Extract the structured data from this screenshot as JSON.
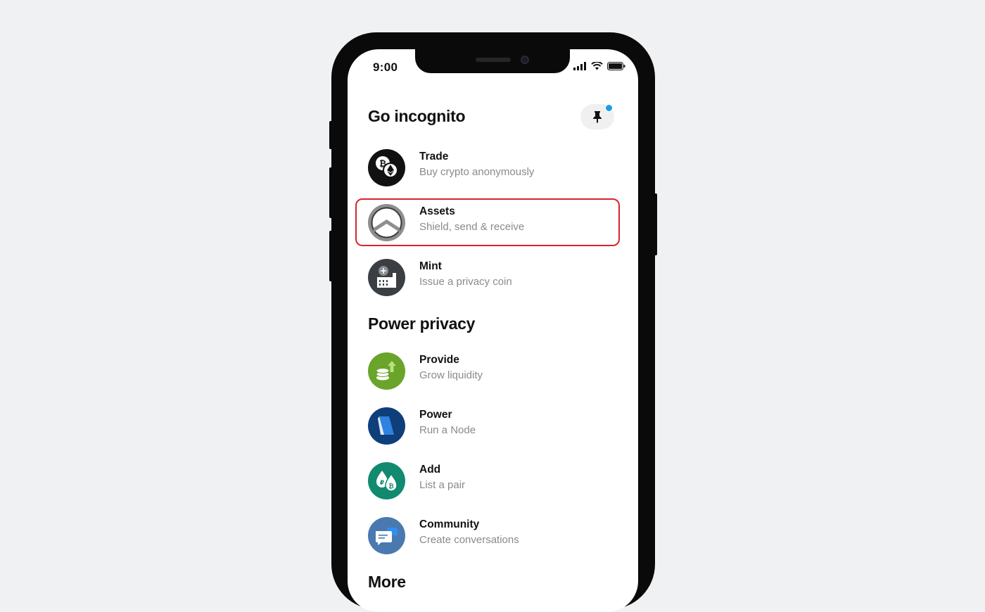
{
  "status_bar": {
    "time": "9:00"
  },
  "sections": {
    "go_incognito": {
      "title": "Go incognito"
    },
    "power_privacy": {
      "title": "Power privacy"
    },
    "more": {
      "title": "More"
    }
  },
  "items": [
    {
      "title": "Trade",
      "subtitle": "Buy crypto anonymously",
      "icon": "trade-crypto-icon",
      "color": "#111111"
    },
    {
      "title": "Assets",
      "subtitle": "Shield, send & receive",
      "icon": "assets-shield-icon",
      "color": "#8e8e8e",
      "highlighted": true
    },
    {
      "title": "Mint",
      "subtitle": "Issue a privacy coin",
      "icon": "mint-factory-icon",
      "color": "#3b3f44"
    },
    {
      "title": "Provide",
      "subtitle": "Grow liquidity",
      "icon": "provide-coins-icon",
      "color": "#6aa42a"
    },
    {
      "title": "Power",
      "subtitle": "Run a Node",
      "icon": "power-node-icon",
      "color": "#0f3f7a"
    },
    {
      "title": "Add",
      "subtitle": "List a pair",
      "icon": "add-pair-icon",
      "color": "#118a6f"
    },
    {
      "title": "Community",
      "subtitle": "Create conversations",
      "icon": "community-chat-icon",
      "color": "#4a79b0"
    }
  ],
  "colors": {
    "highlight": "#d8242c",
    "notification_dot": "#1a9be8",
    "background": "#f0f1f3"
  }
}
